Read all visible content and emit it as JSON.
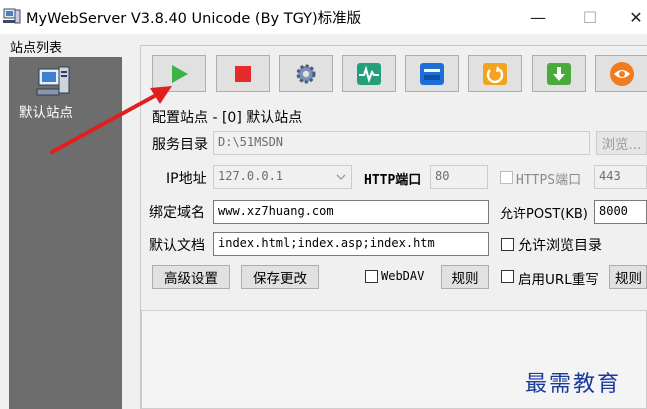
{
  "window": {
    "title": "MyWebServer V3.8.40 Unicode (By TGY)标准版",
    "minimize_glyph": "—",
    "maximize_glyph": "☐",
    "close_glyph": "✕"
  },
  "sidebar": {
    "label": "站点列表",
    "sites": [
      {
        "name": "默认站点",
        "icon": "server-computer-icon"
      }
    ]
  },
  "toolbar": {
    "buttons": [
      {
        "name": "start-button",
        "icon": "play-icon",
        "color": "#3bb34a"
      },
      {
        "name": "stop-button",
        "icon": "stop-icon",
        "color": "#e52b2b"
      },
      {
        "name": "settings-button",
        "icon": "gear-icon",
        "color": "#6a7fa8"
      },
      {
        "name": "monitor-button",
        "icon": "pulse-icon",
        "color": "#23a07a"
      },
      {
        "name": "window-button",
        "icon": "window-icon",
        "color": "#1c6fd6"
      },
      {
        "name": "refresh-button",
        "icon": "refresh-icon",
        "color": "#f2a41e"
      },
      {
        "name": "download-button",
        "icon": "download-icon",
        "color": "#4aab3c"
      },
      {
        "name": "logo-button",
        "icon": "brand-logo-icon",
        "color": "#f17b1d"
      }
    ]
  },
  "config": {
    "heading": "配置站点 - [0] 默认站点",
    "service_dir_label": "服务目录",
    "service_dir_value": "D:\\51MSDN",
    "browse_label": "浏览...",
    "ip_label": "IP地址",
    "ip_value": "127.0.0.1",
    "http_port_label": "HTTP端口",
    "http_port_value": "80",
    "https_port_label": "HTTPS端口",
    "https_port_value": "443",
    "domain_label": "绑定域名",
    "domain_value": "www.xz7huang.com",
    "post_label": "允许POST(KB)",
    "post_value": "8000",
    "default_doc_label": "默认文档",
    "default_doc_value": "index.html;index.asp;index.htm",
    "allow_browse_label": "允许浏览目录",
    "advanced_label": "高级设置",
    "save_label": "保存更改",
    "webdav_label": "WebDAV",
    "rules_label": "规则",
    "url_rewrite_label": "启用URL重写",
    "rules2_label": "规则"
  },
  "watermark": "最需教育",
  "colors": {
    "accent_arrow": "#e02020",
    "sidebar_bg": "#6d6d6d"
  }
}
